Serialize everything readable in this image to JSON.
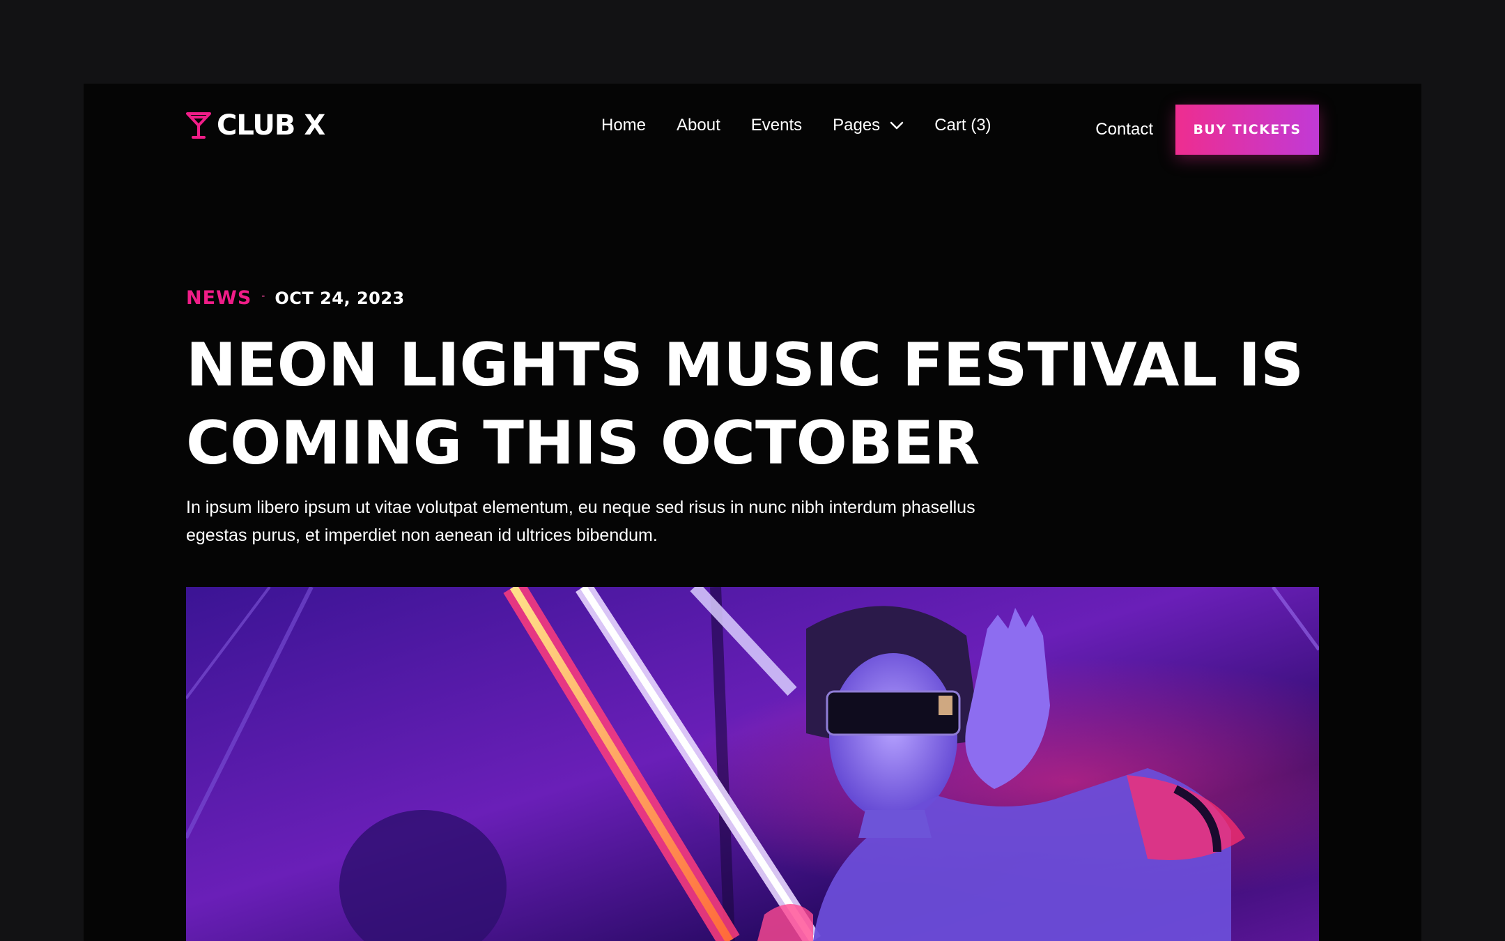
{
  "header": {
    "logo_text": "CLUB X",
    "logo_icon": "cocktail-glass-icon",
    "nav": [
      {
        "label": "Home"
      },
      {
        "label": "About"
      },
      {
        "label": "Events"
      },
      {
        "label": "Pages",
        "icon": "chevron-down-icon"
      },
      {
        "label": "Cart (3)"
      }
    ],
    "contact_label": "Contact",
    "cta_label": "BUY TICKETS"
  },
  "article": {
    "category": "NEWS",
    "separator": "-",
    "date": "OCT 24, 2023",
    "title_line1": "NEON LIGHTS MUSIC FESTIVAL IS",
    "title_line2": "COMING THIS OCTOBER",
    "lede_line1": "In ipsum libero ipsum ut vitae volutpat elementum, eu neque sed risus in nunc nibh interdum phasellus",
    "lede_line2": "egestas purus, et imperdiet non aenean id ultrices bibendum."
  },
  "colors": {
    "accent": "#f01d88",
    "cta_gradient_start": "#ee2d8f",
    "cta_gradient_end": "#c13ad6",
    "page_bg": "#121214",
    "frame_bg": "#050505"
  }
}
